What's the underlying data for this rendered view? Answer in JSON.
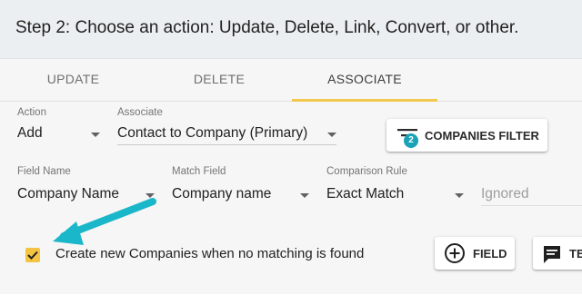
{
  "header": {
    "title": "Step 2: Choose an action: Update, Delete, Link, Convert, or other."
  },
  "tabs": [
    {
      "label": "UPDATE"
    },
    {
      "label": "DELETE"
    },
    {
      "label": "ASSOCIATE"
    }
  ],
  "active_tab": "ASSOCIATE",
  "accent_color": "#f2c94c",
  "action": {
    "label": "Action",
    "value": "Add"
  },
  "associate": {
    "label": "Associate",
    "value": "Contact to Company (Primary)"
  },
  "companies_filter": {
    "label": "COMPANIES FILTER",
    "badge": "2",
    "icon": "filter-icon"
  },
  "field_name": {
    "label": "Field Name",
    "value": "Company Name"
  },
  "match_field": {
    "label": "Match Field",
    "value": "Company name"
  },
  "comparison_rule": {
    "label": "Comparison Rule",
    "value": "Exact Match"
  },
  "ignored": {
    "placeholder": "Ignored"
  },
  "create_new": {
    "label": "Create new Companies when no matching is found",
    "checked": true
  },
  "field_button": {
    "label": "FIELD",
    "icon": "add-circle-icon"
  },
  "text_button": {
    "label": "TE",
    "icon": "text-icon"
  }
}
